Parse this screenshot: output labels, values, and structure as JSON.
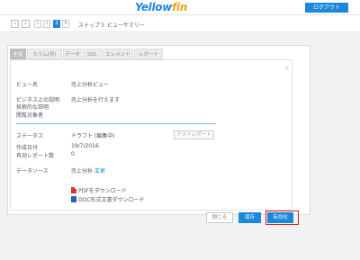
{
  "header": {
    "logo_part1": "Yellow",
    "logo_part2": "fin",
    "logout_label": "ログアウト"
  },
  "nav": {
    "prev_icon": "‹",
    "next_icon": "›",
    "steps": [
      "1",
      "2",
      "3",
      "4"
    ],
    "active_step": "3",
    "title": "ステップ３ ビューサマリー"
  },
  "tabs": [
    "全般",
    "カラム(列)",
    "データ",
    "SQL",
    "エレメント",
    "レポート"
  ],
  "active_tab": "全般",
  "close_icon": "×",
  "form": {
    "view_name_label": "ビュー名",
    "view_name_value": "売上分析ビュー",
    "business_desc_label": "ビジネス上の説明",
    "business_desc_value": "売上分析を行えます",
    "tech_desc_label": "技術的な説明",
    "audience_label": "閲覧対象者",
    "status_label": "ステータス",
    "status_value": "ドラフト (編集中)",
    "test_report_label": "テストレポート",
    "created_label": "作成日付",
    "created_value": "19/7/2016",
    "active_reports_label": "有効レポート数",
    "active_reports_value": "0",
    "datasource_label": "データソース",
    "datasource_value": "売上分析",
    "datasource_change": "変更",
    "pdf_download": "PDFをダウンロード",
    "doc_download": "DOC形式文書ダウンロード"
  },
  "footer": {
    "close_label": "閉じる",
    "save_label": "保存",
    "activate_label": "有効化"
  },
  "colors": {
    "accent": "#1e88d8",
    "highlight": "#d81e1e",
    "logo_secondary": "#f7a21b"
  }
}
